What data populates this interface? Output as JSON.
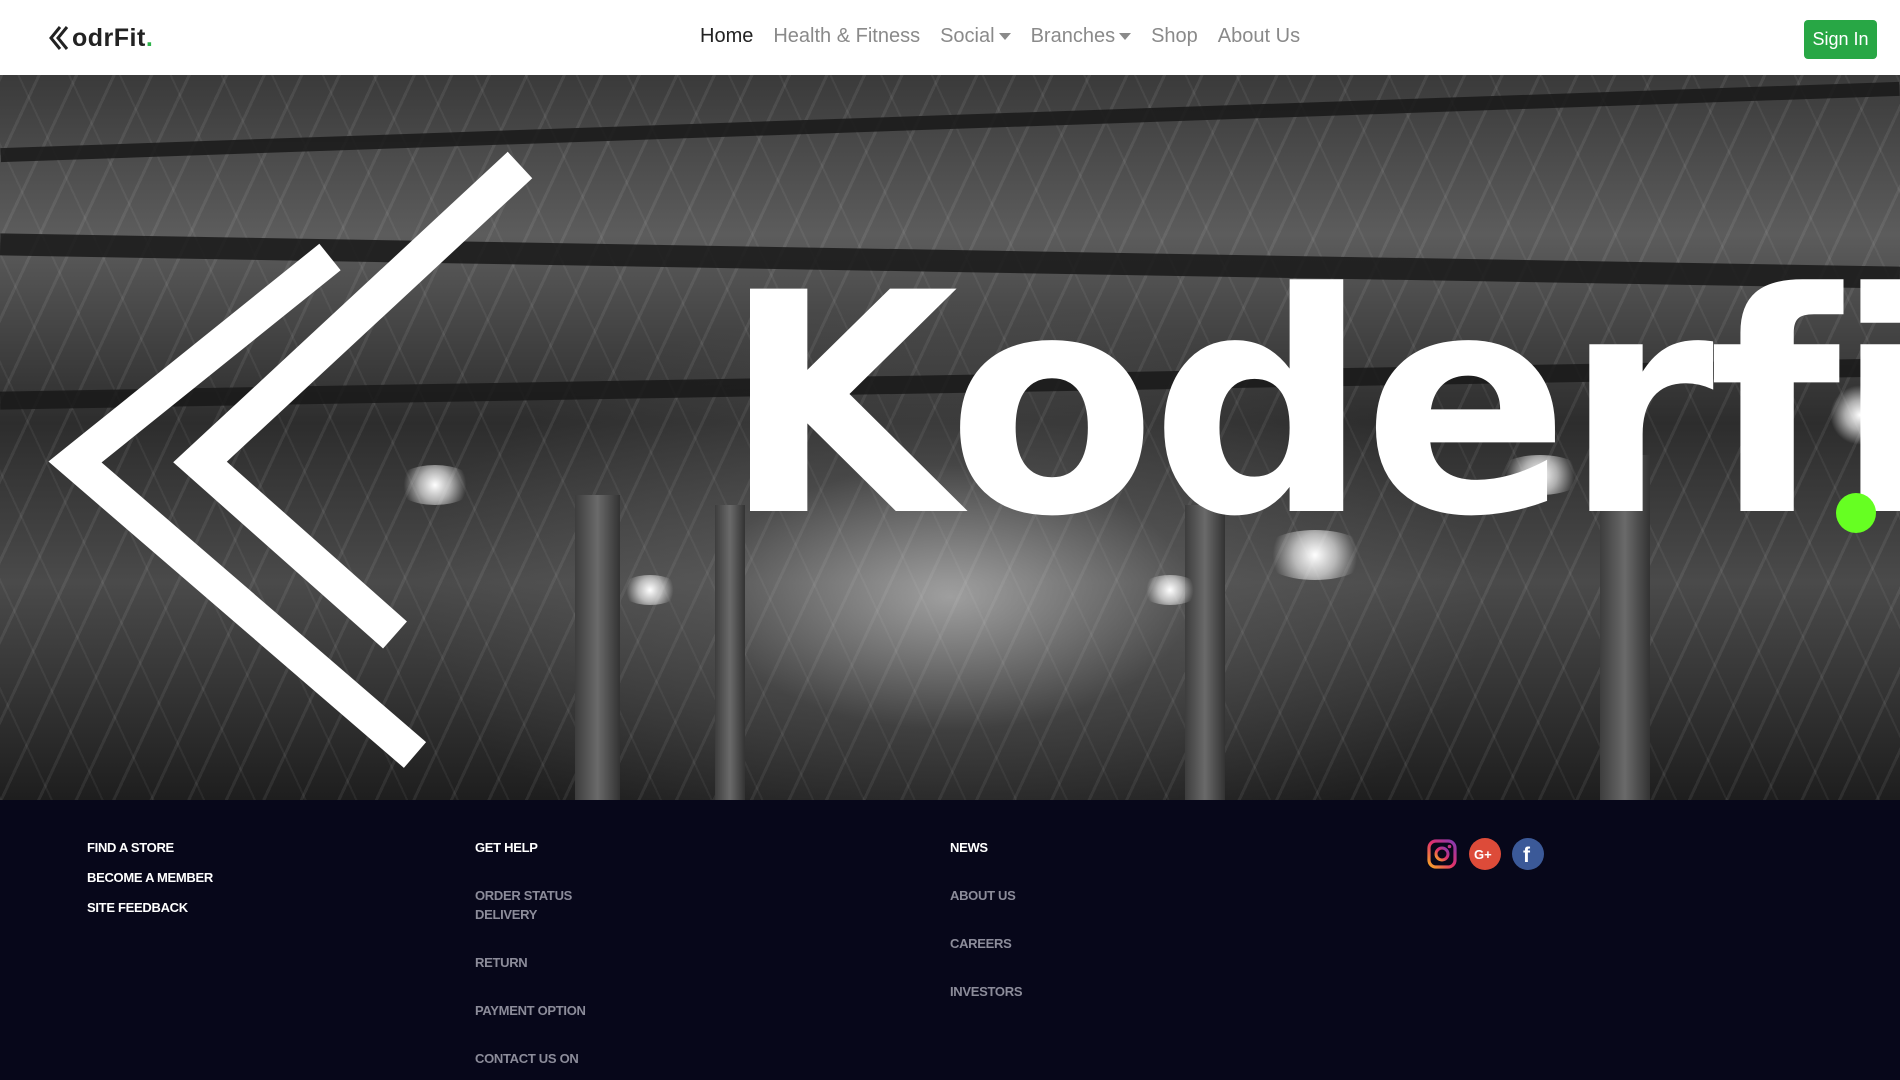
{
  "brand": {
    "text": "odrFit",
    "dot": "."
  },
  "nav": {
    "home": "Home",
    "health": "Health & Fitness",
    "social": "Social",
    "branches": "Branches",
    "shop": "Shop",
    "about": "About Us"
  },
  "signin_label": "Sign In",
  "hero": {
    "wordmark": "Koderfit"
  },
  "footer": {
    "col1": [
      "FIND A STORE",
      "BECOME A MEMBER",
      "SITE FEEDBACK"
    ],
    "col2_title": "GET HELP",
    "col2": [
      "ORDER STATUS",
      "DELIVERY",
      "RETURN",
      "PAYMENT OPTION",
      "CONTACT US ON"
    ],
    "col3_title": "NEWS",
    "col3": [
      "ABOUT US",
      "CAREERS",
      "INVESTORS"
    ]
  },
  "social_icons": [
    "instagram-icon",
    "google-plus-icon",
    "facebook-icon"
  ],
  "colors": {
    "accent_green": "#28a745",
    "dot_green": "#66ff22",
    "footer_bg": "#07071a"
  }
}
